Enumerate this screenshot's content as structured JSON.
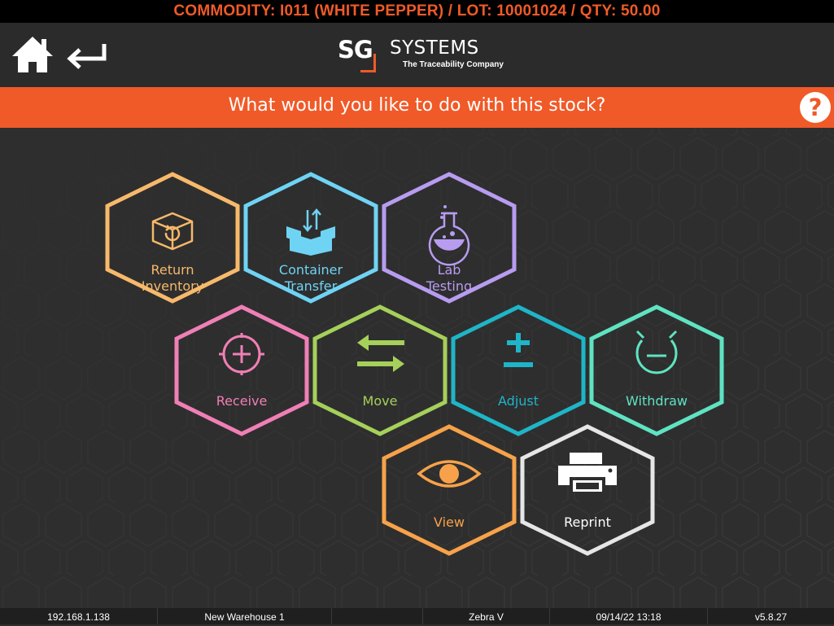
{
  "commodity_bar": "COMMODITY: I011 (WHITE PEPPER) / LOT: 10001024 / QTY: 50.00",
  "logo": {
    "sg": "SG",
    "systems": "SYSTEMS",
    "tagline": "The Traceability Company"
  },
  "page_title": "What would you like to do with this stock?",
  "help_label": "?",
  "actions": [
    {
      "id": "return-inventory",
      "lines": [
        "Return",
        "Inventory"
      ],
      "color": "#f7b96b",
      "icon": "return-box-icon"
    },
    {
      "id": "container-transfer",
      "lines": [
        "Container",
        "Transfer"
      ],
      "color": "#6fd3f4",
      "icon": "container-transfer-icon"
    },
    {
      "id": "lab-testing",
      "lines": [
        "Lab",
        "Testing"
      ],
      "color": "#b79cf0",
      "icon": "flask-icon"
    },
    {
      "id": "receive",
      "lines": [
        "Receive"
      ],
      "color": "#f07fb5",
      "icon": "crosshair-plus-icon"
    },
    {
      "id": "move",
      "lines": [
        "Move"
      ],
      "color": "#a5d05a",
      "icon": "arrows-swap-icon"
    },
    {
      "id": "adjust",
      "lines": [
        "Adjust"
      ],
      "color": "#1fb5c8",
      "icon": "plus-minus-icon"
    },
    {
      "id": "withdraw",
      "lines": [
        "Withdraw"
      ],
      "color": "#5fe3c2",
      "icon": "withdraw-icon"
    },
    {
      "id": "view",
      "lines": [
        "View"
      ],
      "color": "#f7a24a",
      "icon": "eye-icon"
    },
    {
      "id": "reprint",
      "lines": [
        "Reprint"
      ],
      "color": "#e6e6e6",
      "icon": "printer-icon"
    }
  ],
  "status": {
    "ip": "192.168.1.138",
    "warehouse": "New Warehouse 1",
    "extra": "",
    "printer": "Zebra V",
    "datetime": "09/14/22 13:18",
    "version": "v5.8.27"
  },
  "colors": {
    "accent": "#f05a28",
    "background": "#2e2e2e"
  }
}
